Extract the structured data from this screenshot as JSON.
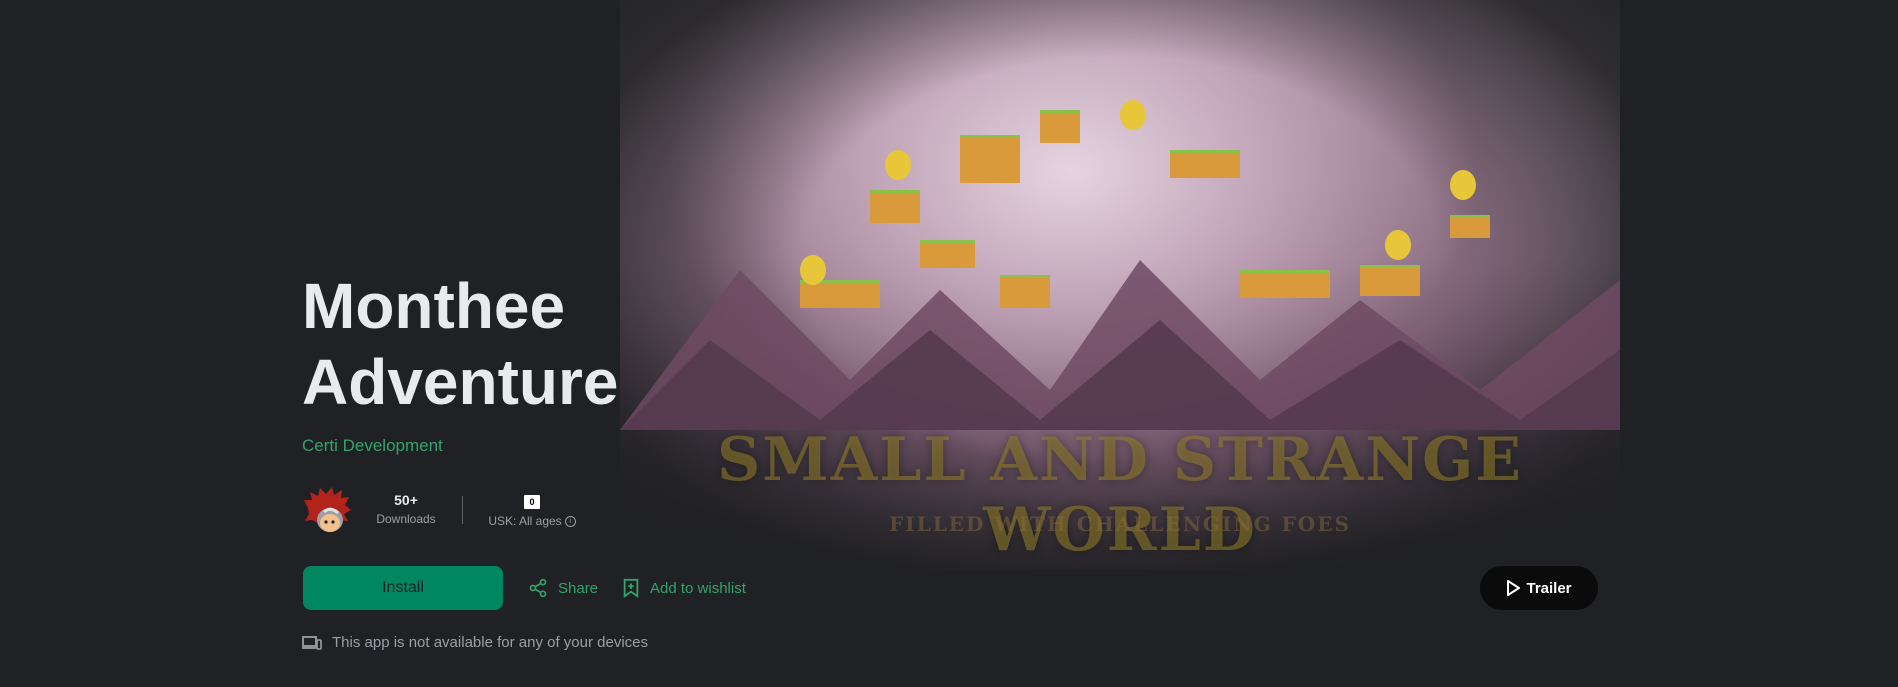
{
  "app": {
    "title_line1": "Monthee",
    "title_line2": "Adventure",
    "developer": "Certi Development"
  },
  "hero": {
    "tagline_main": "SMALL AND STRANGE WORLD",
    "tagline_sub": "FILLED WITH CHALLENGING FOES"
  },
  "stats": {
    "downloads_value": "50+",
    "downloads_label": "Downloads",
    "usk_badge": "0",
    "rating_label": "USK: All ages"
  },
  "actions": {
    "install_label": "Install",
    "share_label": "Share",
    "wishlist_label": "Add to wishlist",
    "trailer_label": "Trailer"
  },
  "availability": {
    "message": "This app is not available for any of your devices"
  },
  "colors": {
    "background": "#202124",
    "accent": "#01875f",
    "accent_text": "#34a36b"
  },
  "icons": {
    "share": "share-icon",
    "wishlist": "bookmark-add-icon",
    "play": "play-icon",
    "devices": "devices-icon",
    "info": "info-icon"
  }
}
